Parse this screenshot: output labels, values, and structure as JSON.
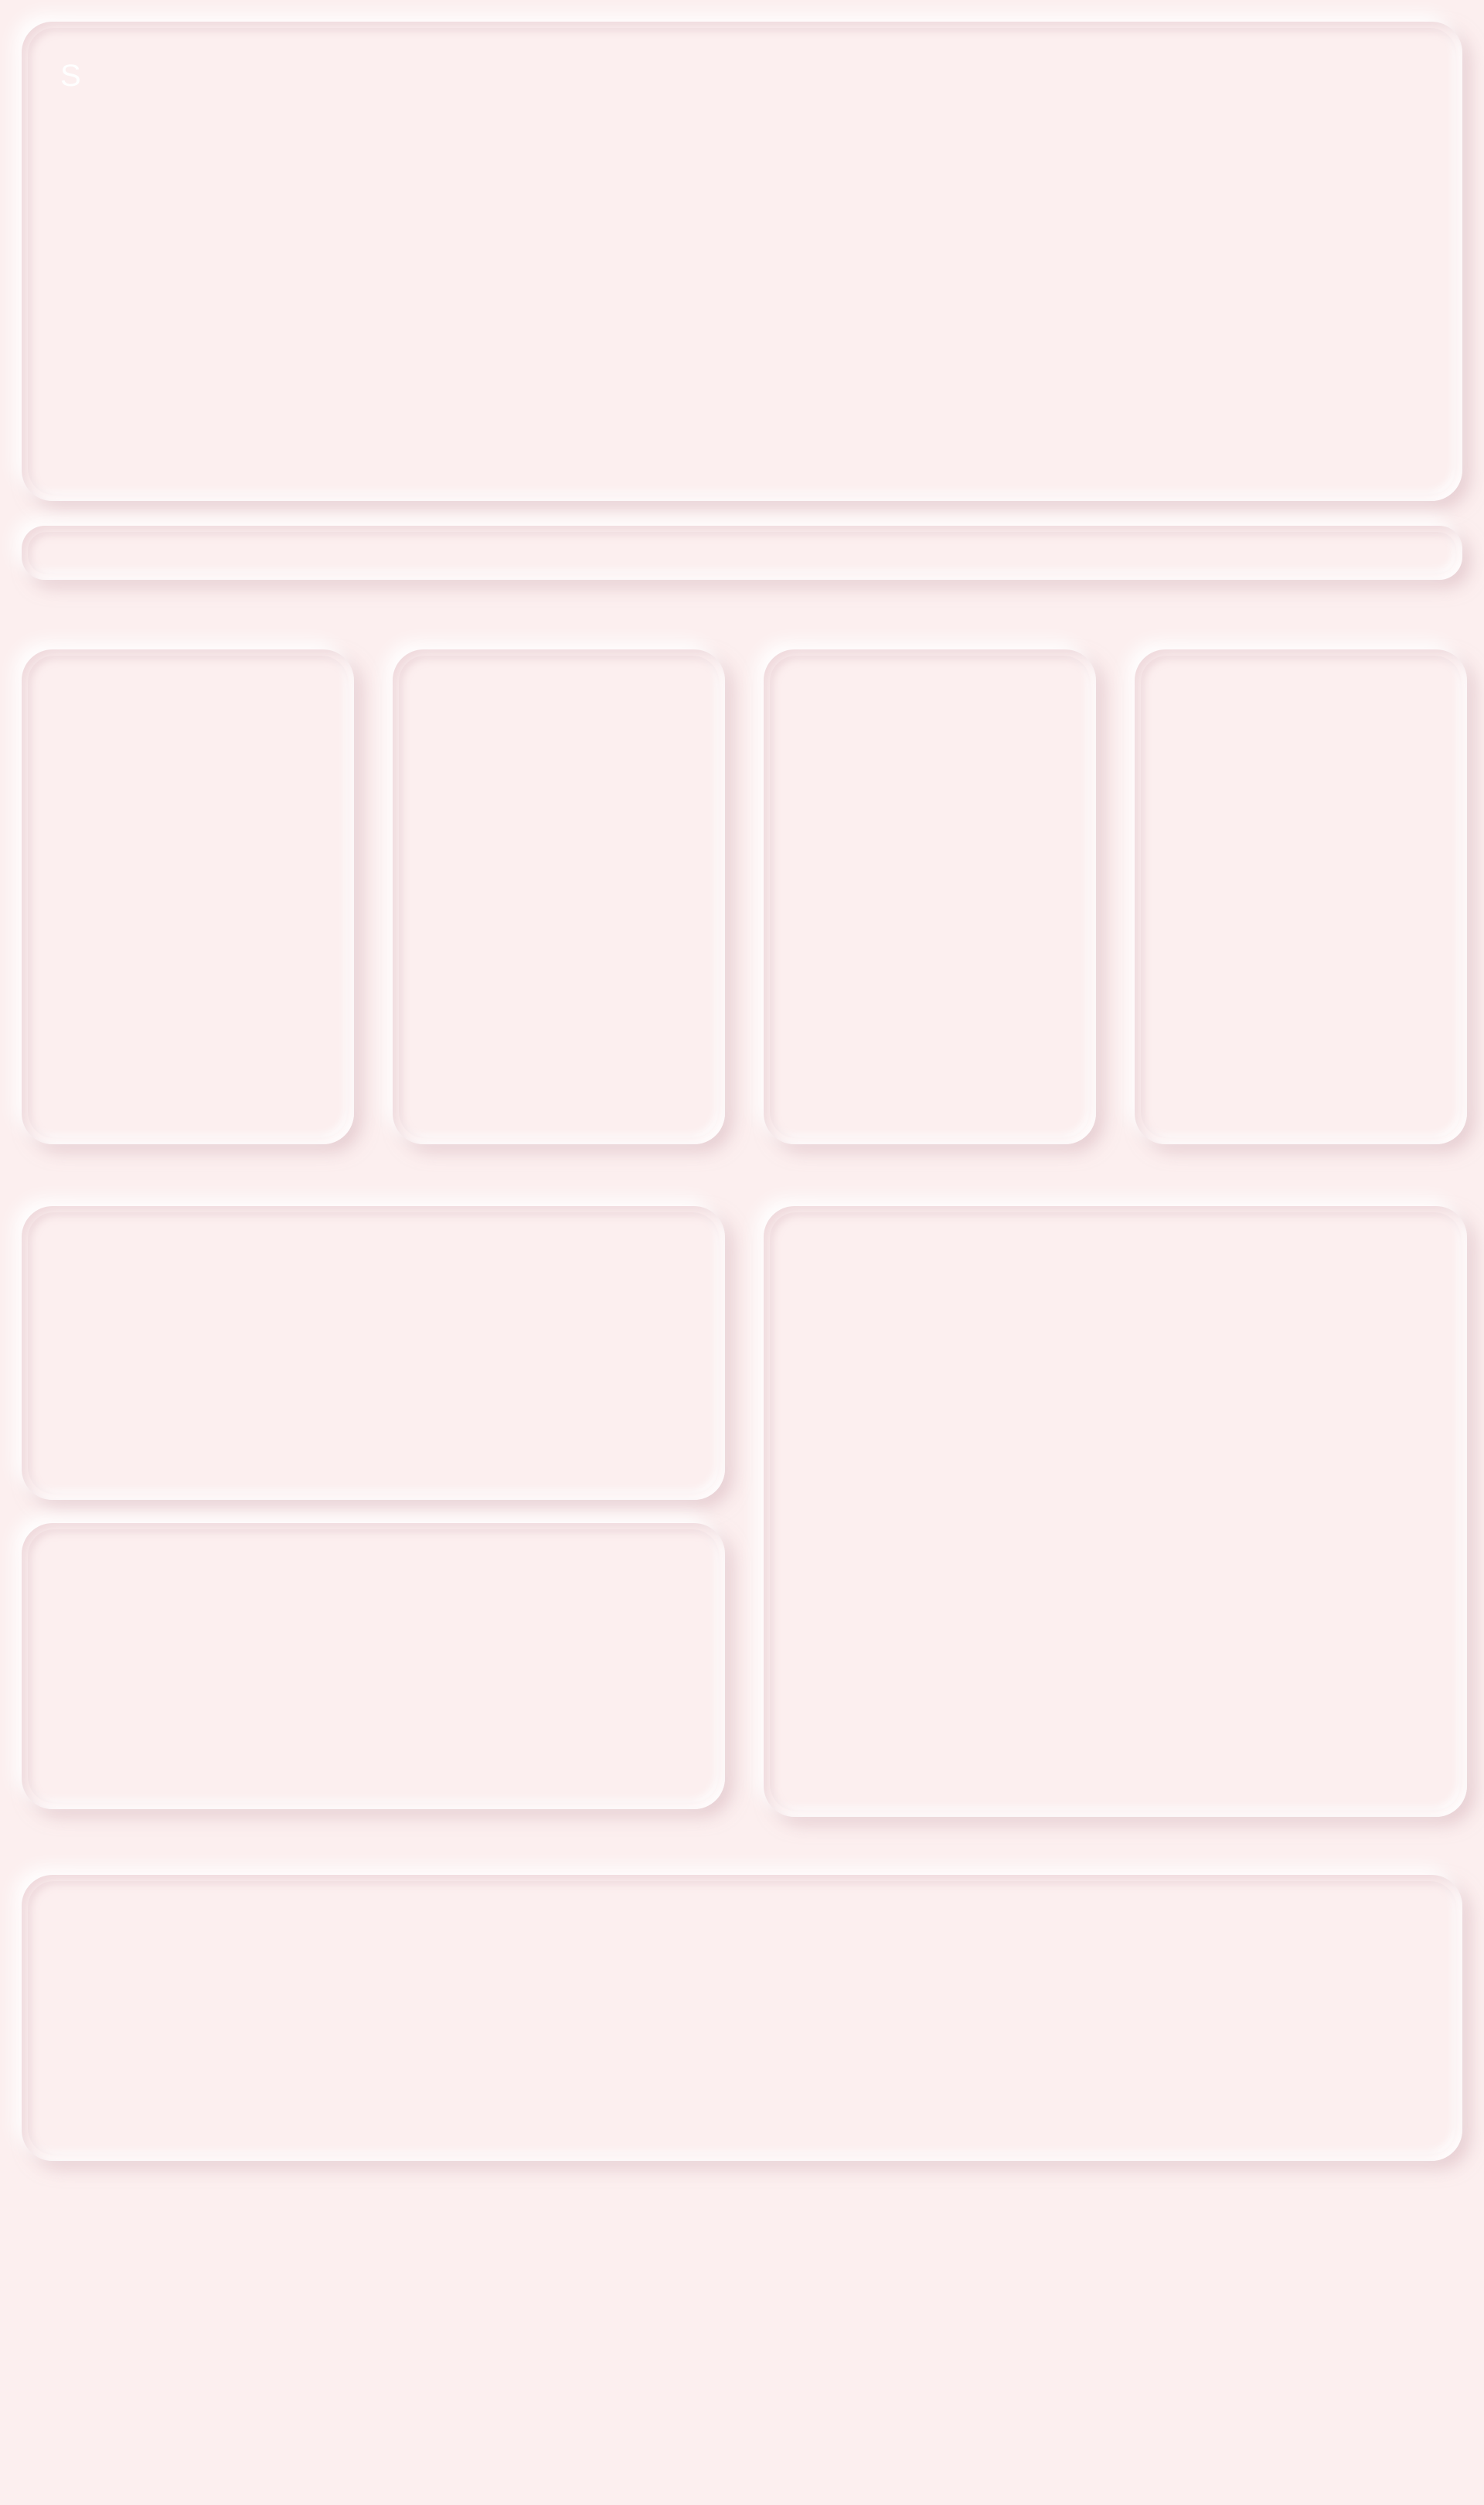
{
  "hero": {
    "mark": "S"
  },
  "colors": {
    "background": "#fcefef",
    "shadow": "#d6b2ba",
    "highlight": "#ffffff"
  }
}
